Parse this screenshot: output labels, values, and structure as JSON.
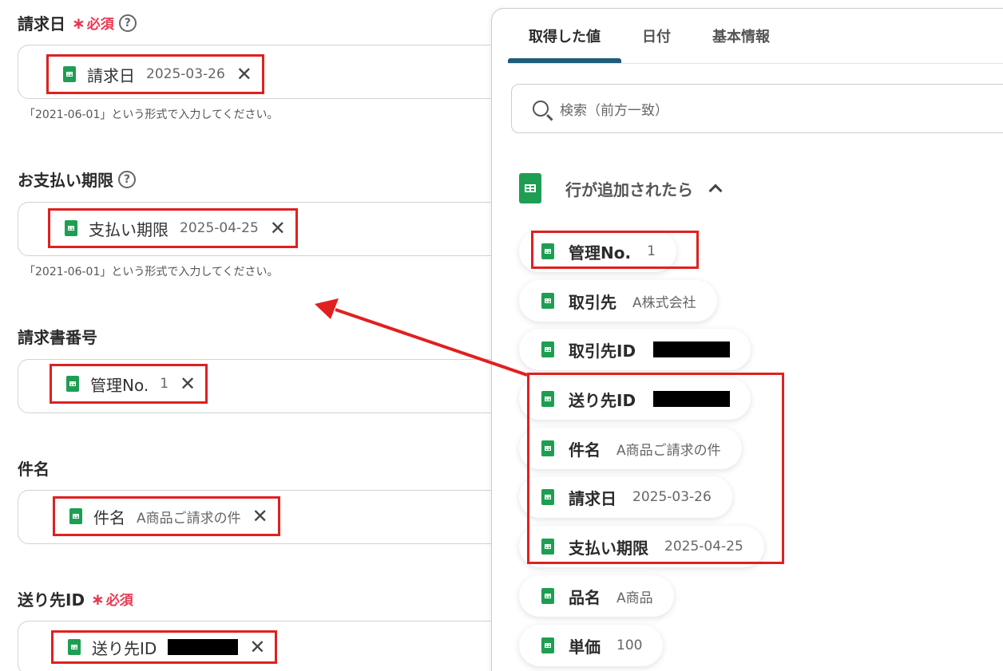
{
  "form": {
    "invoice_date": {
      "label": "請求日",
      "required": "必須",
      "chip_name": "請求日",
      "chip_value": "2025-03-26",
      "hint": "「2021-06-01」という形式で入力してください。"
    },
    "due_date": {
      "label": "お支払い期限",
      "chip_name": "支払い期限",
      "chip_value": "2025-04-25",
      "hint": "「2021-06-01」という形式で入力してください。"
    },
    "invoice_number": {
      "label": "請求書番号",
      "chip_name": "管理No.",
      "chip_value": "1"
    },
    "subject": {
      "label": "件名",
      "chip_name": "件名",
      "chip_value": "A商品ご請求の件"
    },
    "recipient_id": {
      "label": "送り先ID",
      "required": "必須",
      "chip_name": "送り先ID"
    },
    "help_glyph": "?",
    "required_star": "∗",
    "remove_glyph": "✕"
  },
  "panel": {
    "tabs": [
      "取得した値",
      "日付",
      "基本情報"
    ],
    "search_placeholder": "検索（前方一致）",
    "group_title": "行が追加されたら",
    "items": [
      {
        "name": "管理No.",
        "value": "1"
      },
      {
        "name": "取引先",
        "value": "A株式会社"
      },
      {
        "name": "取引先ID",
        "value": ""
      },
      {
        "name": "送り先ID",
        "value": ""
      },
      {
        "name": "件名",
        "value": "A商品ご請求の件"
      },
      {
        "name": "請求日",
        "value": "2025-03-26"
      },
      {
        "name": "支払い期限",
        "value": "2025-04-25"
      },
      {
        "name": "品名",
        "value": "A商品"
      },
      {
        "name": "単価",
        "value": "100"
      }
    ]
  },
  "colors": {
    "accent_red": "#e02020",
    "sheet_green": "#1e9e52",
    "tab_underline": "#1f5d7a",
    "required": "#e8384f"
  }
}
